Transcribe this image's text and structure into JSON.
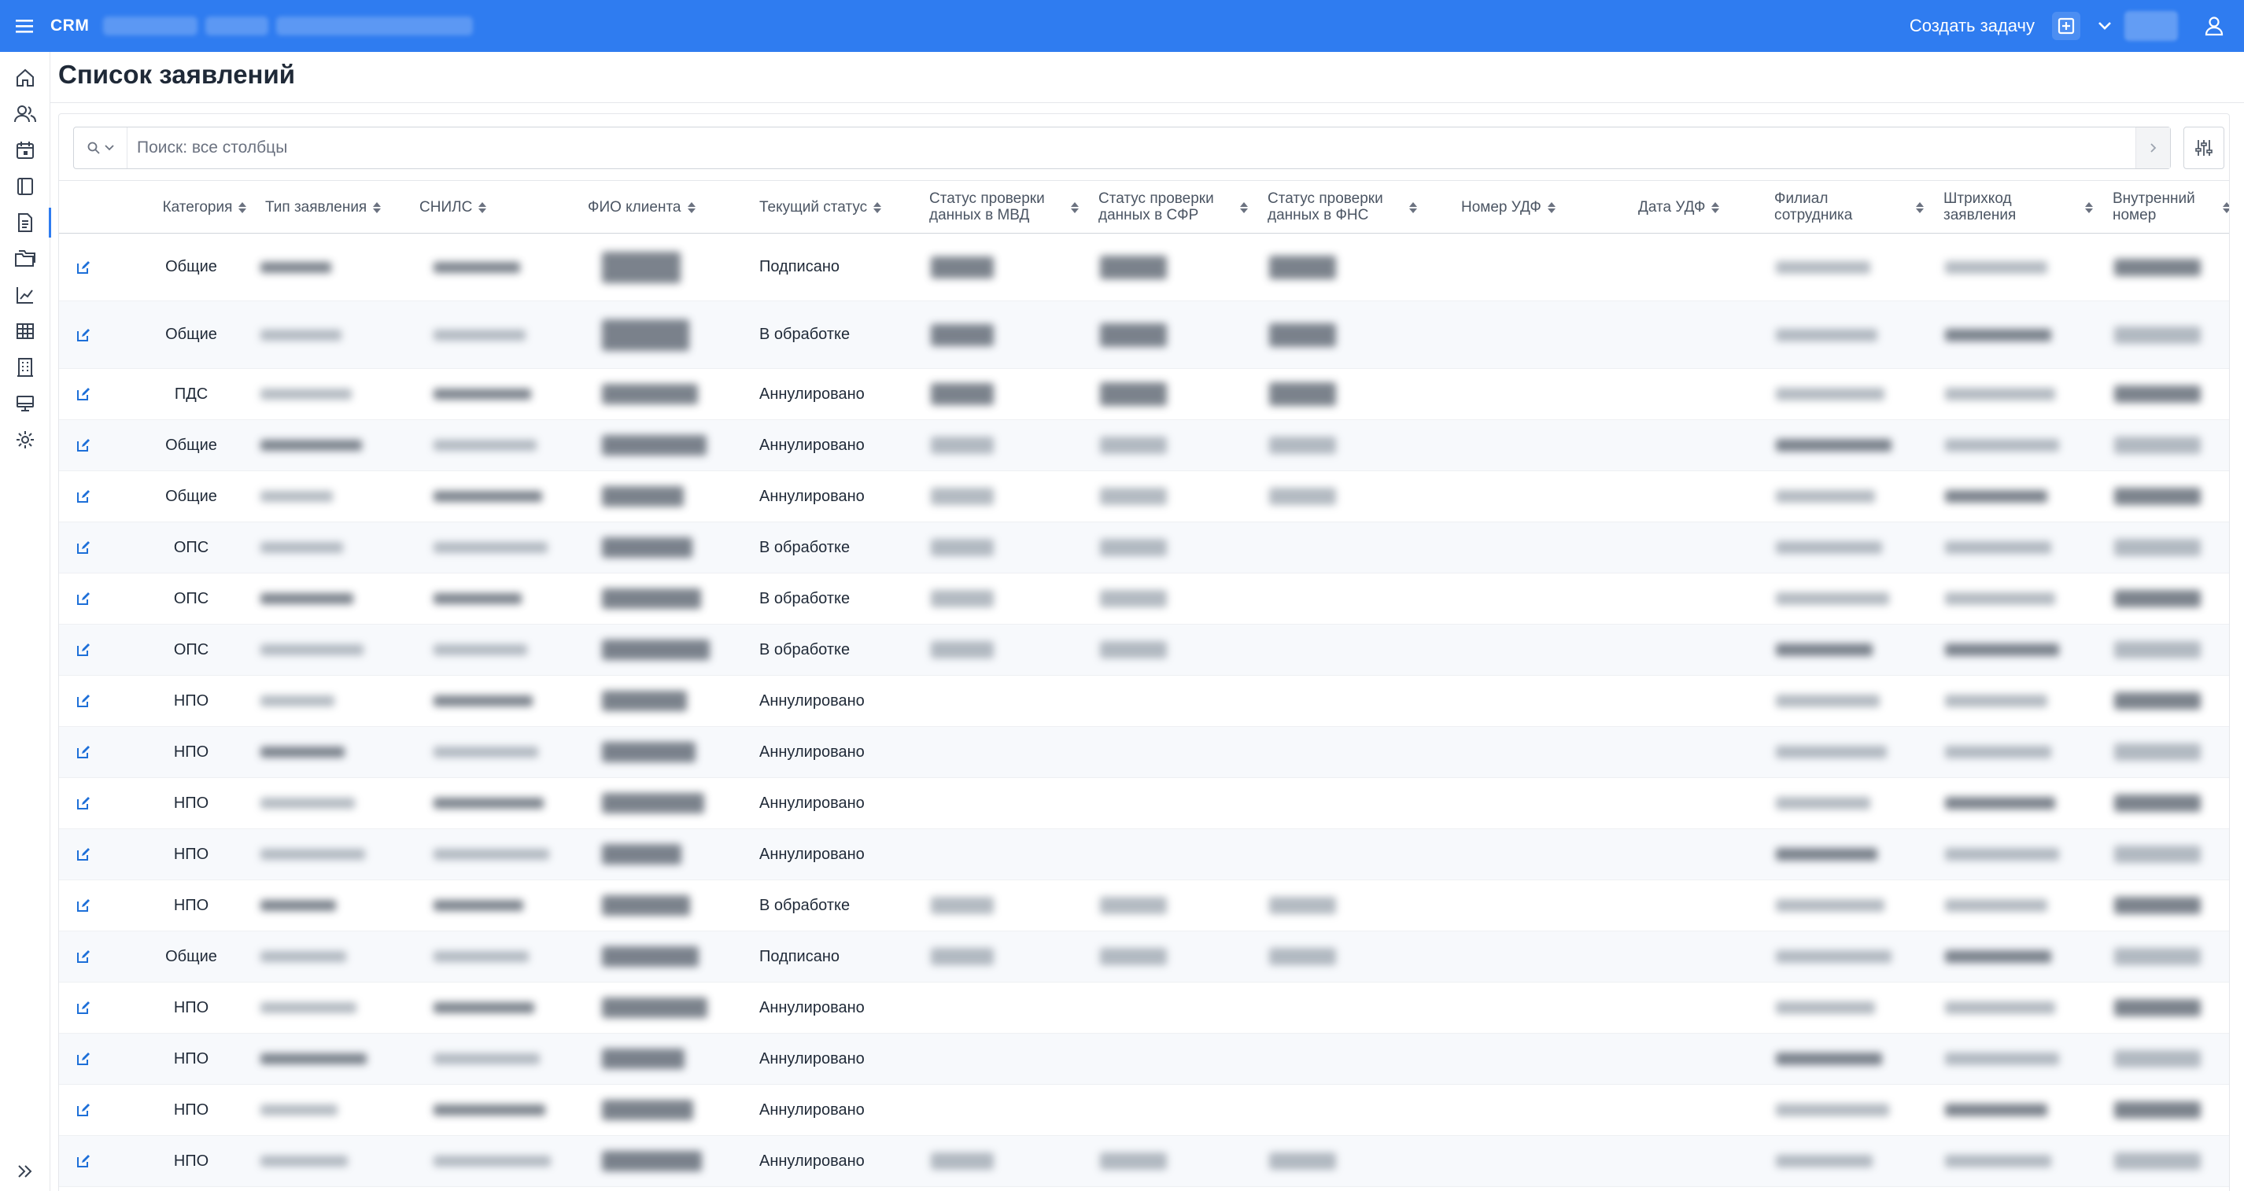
{
  "topbar": {
    "brand": "CRM",
    "create_task": "Создать задачу"
  },
  "sidebar": {
    "items": [
      {
        "icon": "home-icon"
      },
      {
        "icon": "users-icon"
      },
      {
        "icon": "calendar-icon"
      },
      {
        "icon": "book-icon"
      },
      {
        "icon": "document-icon",
        "active": true
      },
      {
        "icon": "folders-icon"
      },
      {
        "icon": "chart-line-icon"
      },
      {
        "icon": "table-icon"
      },
      {
        "icon": "building-icon"
      },
      {
        "icon": "monitor-icon"
      },
      {
        "icon": "gear-icon"
      }
    ],
    "expand_icon": "double-chevron-right-icon"
  },
  "page": {
    "title": "Список заявлений"
  },
  "search": {
    "placeholder": "Поиск: все столбцы"
  },
  "table": {
    "columns": [
      {
        "key": "category",
        "label": "Категория"
      },
      {
        "key": "type",
        "label": "Тип заявления"
      },
      {
        "key": "snils",
        "label": "СНИЛС"
      },
      {
        "key": "fio",
        "label": "ФИО клиента"
      },
      {
        "key": "status",
        "label": "Текущий статус"
      },
      {
        "key": "mvd",
        "label": "Статус проверки данных в МВД"
      },
      {
        "key": "sfr",
        "label": "Статус проверки данных в СФР"
      },
      {
        "key": "fns",
        "label": "Статус проверки данных в ФНС"
      },
      {
        "key": "udf_no",
        "label": "Номер УДФ"
      },
      {
        "key": "udf_date",
        "label": "Дата УДФ"
      },
      {
        "key": "branch",
        "label": "Филиал сотрудника"
      },
      {
        "key": "barcode",
        "label": "Штрихкод заявления"
      },
      {
        "key": "internal",
        "label": "Внутренний номер"
      }
    ],
    "rows": [
      {
        "category": "Общие",
        "status": "Подписано"
      },
      {
        "category": "Общие",
        "status": "В обработке"
      },
      {
        "category": "ПДС",
        "status": "Аннулировано"
      },
      {
        "category": "Общие",
        "status": "Аннулировано"
      },
      {
        "category": "Общие",
        "status": "Аннулировано"
      },
      {
        "category": "ОПС",
        "status": "В обработке"
      },
      {
        "category": "ОПС",
        "status": "В обработке"
      },
      {
        "category": "ОПС",
        "status": "В обработке"
      },
      {
        "category": "НПО",
        "status": "Аннулировано"
      },
      {
        "category": "НПО",
        "status": "Аннулировано"
      },
      {
        "category": "НПО",
        "status": "Аннулировано"
      },
      {
        "category": "НПО",
        "status": "Аннулировано"
      },
      {
        "category": "НПО",
        "status": "В обработке"
      },
      {
        "category": "Общие",
        "status": "Подписано"
      },
      {
        "category": "НПО",
        "status": "Аннулировано"
      },
      {
        "category": "НПО",
        "status": "Аннулировано"
      },
      {
        "category": "НПО",
        "status": "Аннулировано"
      },
      {
        "category": "НПО",
        "status": "Аннулировано"
      }
    ]
  },
  "colors": {
    "accent": "#2f7cf0",
    "edit_icon": "#1d6fd8"
  }
}
